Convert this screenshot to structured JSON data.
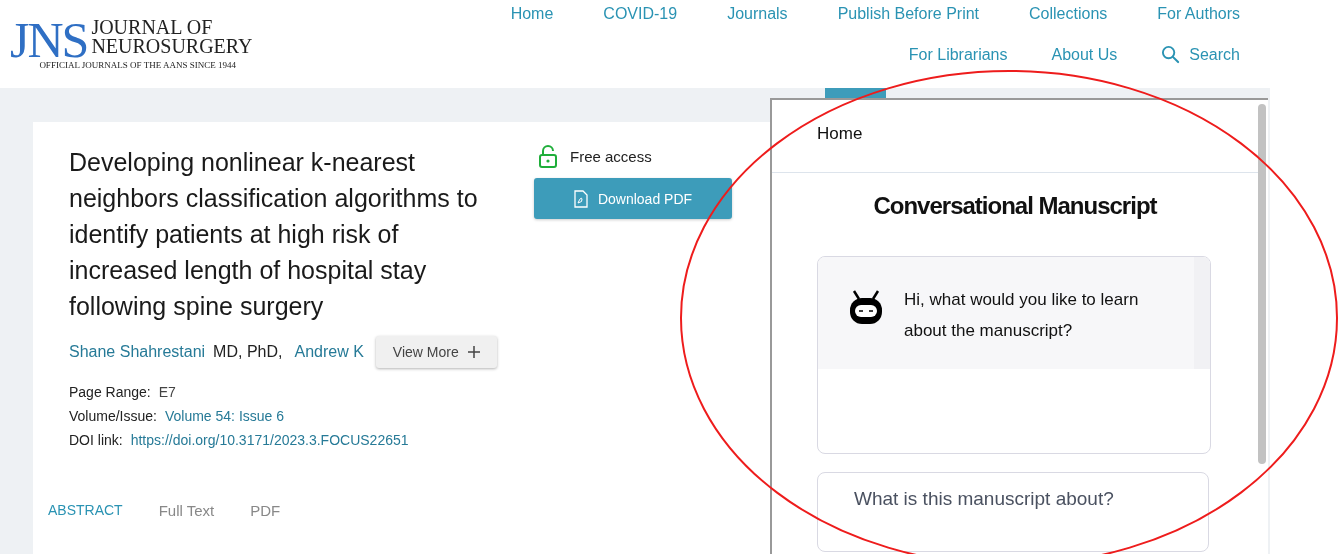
{
  "logo": {
    "mark": "JNS",
    "name_line_1": "JOURNAL OF",
    "name_line_2": "NEUROSURGERY",
    "tagline": "OFFICIAL JOURNALS OF THE AANS SINCE 1944"
  },
  "nav": {
    "row_1": [
      "Home",
      "COVID-19",
      "Journals",
      "Publish Before Print",
      "Collections",
      "For Authors"
    ],
    "row_2": [
      "For Librarians",
      "About Us",
      "Search"
    ]
  },
  "article": {
    "title": "Developing nonlinear k-nearest neighbors classification algorithms to identify patients at high risk of increased length of hospital stay following spine surgery",
    "access": "Free access",
    "download": "Download PDF",
    "authors": [
      {
        "name": "Shane Shahrestani",
        "credentials": "MD, PhD,"
      },
      {
        "name": "Andrew K"
      }
    ],
    "view_more": "View More",
    "meta": [
      {
        "label": "Page Range:",
        "value": "E7",
        "kind": "text"
      },
      {
        "label": "Volume/Issue:",
        "value": "Volume 54: Issue 6",
        "kind": "link"
      },
      {
        "label": "DOI link:",
        "value": "https://doi.org/10.3171/2023.3.FOCUS22651",
        "kind": "link"
      }
    ],
    "tabs": [
      {
        "label": "ABSTRACT",
        "selected": true
      },
      {
        "label": "Full Text",
        "selected": false
      },
      {
        "label": "PDF",
        "selected": false
      }
    ]
  },
  "chat": {
    "home": "Home",
    "title": "Conversational Manuscript",
    "greeting": "Hi, what would you like to learn about the manuscript?",
    "input": {
      "placeholder": "What is this manuscript about?"
    }
  }
}
